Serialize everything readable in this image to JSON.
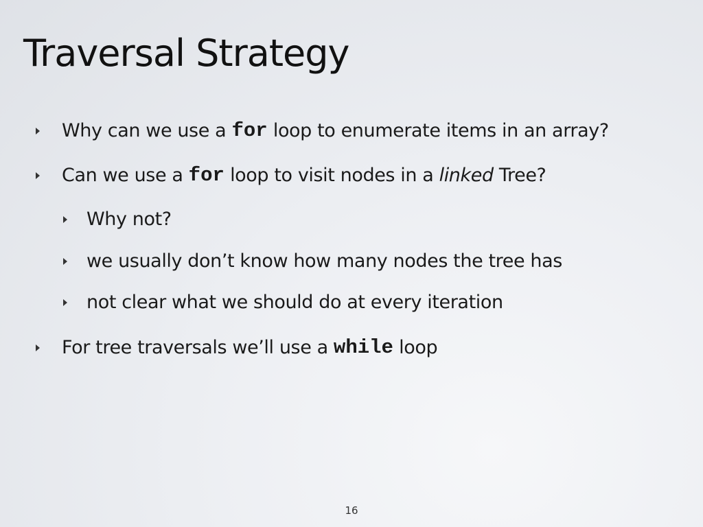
{
  "slide": {
    "title": "Traversal Strategy",
    "page_number": "16"
  },
  "bullets": [
    {
      "level": 1,
      "parts": [
        "Why can we use a ",
        "for",
        " loop to enumerate items in an array?"
      ]
    },
    {
      "level": 1,
      "parts": [
        "Can we use a ",
        "for",
        " loop to visit nodes in a ",
        "linked",
        " Tree?"
      ]
    },
    {
      "level": 2,
      "text": "Why not?"
    },
    {
      "level": 2,
      "text": "we usually don’t know how many nodes the tree has"
    },
    {
      "level": 2,
      "text": "not clear what we should do at every iteration"
    },
    {
      "level": 1,
      "parts": [
        "For tree traversals we’ll use a ",
        "while",
        " loop"
      ]
    }
  ],
  "icons": {
    "bullet": "triangle-bullet-icon"
  }
}
